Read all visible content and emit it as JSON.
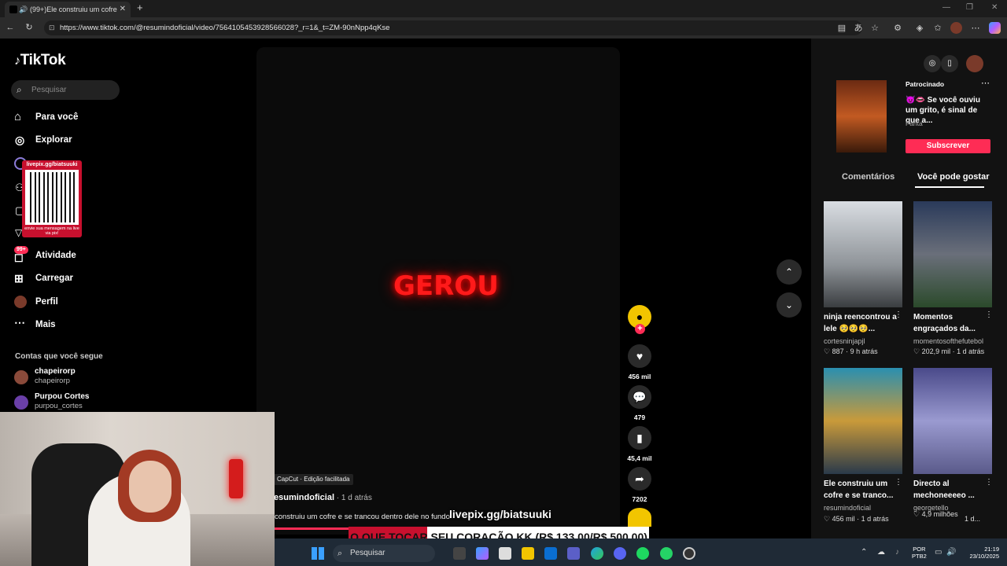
{
  "browser": {
    "tab_title": "(99+)Ele construiu um cofre",
    "url": "https://www.tiktok.com/@resumindoficial/video/7564105453928566028?_r=1&_t=ZM-90nNpp4qKse"
  },
  "sidebar": {
    "logo": "TikTok",
    "search_placeholder": "Pesquisar",
    "items": [
      {
        "label": "Para você",
        "icon": "home-icon"
      },
      {
        "label": "Explorar",
        "icon": "compass-icon"
      },
      {
        "label": "Atividade",
        "icon": "inbox-icon",
        "badge": "99+"
      },
      {
        "label": "Carregar",
        "icon": "plus-square-icon"
      },
      {
        "label": "Perfil",
        "icon": "avatar"
      },
      {
        "label": "Mais",
        "icon": "more-icon"
      }
    ],
    "following_title": "Contas que você segue",
    "following": [
      {
        "name": "chapeirorp",
        "handle": "chapeirorp"
      },
      {
        "name": "Purpou Cortes",
        "handle": "purpou_cortes"
      }
    ]
  },
  "qr_overlay": {
    "top_text": "livepix.gg/biatsuuki",
    "bottom_text": "envie sua mensagem na live via pix!"
  },
  "video": {
    "center_text": "GEROU",
    "capcut_tag": "CapCut · Edição facilitada",
    "username": "esumindoficial",
    "time_ago": " · 1 d atrás",
    "description": "construiu um cofre e se trancou dentro dele no fundo",
    "progress": 0.22
  },
  "actions": [
    {
      "name": "like",
      "count": "456 mil",
      "icon": "heart-icon"
    },
    {
      "name": "comment",
      "count": "479",
      "icon": "comment-icon"
    },
    {
      "name": "bookmark",
      "count": "45,4 mil",
      "icon": "bookmark-icon"
    },
    {
      "name": "share",
      "count": "7202",
      "icon": "share-icon"
    }
  ],
  "right_panel": {
    "ad": {
      "sponsored": "Patrocinado",
      "text": "😈👄 Se você ouviu um grito, é sinal de que a...",
      "brand": "Fanta",
      "button": "Subscrever"
    },
    "tabs": [
      "Comentários",
      "Você pode gostar"
    ],
    "cards": [
      {
        "title": "ninja reencontrou a lele 🥺🥺🥺...",
        "user": "cortesninjapjl",
        "likes": "887",
        "time": "9 h atrás"
      },
      {
        "title": "Momentos engraçados da...",
        "user": "momentosofthefutebol",
        "likes": "202,9 mil",
        "time": "1 d atrás"
      },
      {
        "title": "Ele construiu um cofre e se tranco...",
        "user": "resumindoficial",
        "likes": "456 mil",
        "time": "1 d atrás"
      },
      {
        "title": "Directo al mechoneeeeo ...",
        "user": "georgetello",
        "likes": "4,9 milhões",
        "time": "1 d..."
      }
    ]
  },
  "stream_overlay": {
    "livepix": "livepix.gg/biatsuuki",
    "ticker": "O QUE TOCAR SEU CORAÇÃO KK (R$ 133,00/R$ 500,00)"
  },
  "taskbar": {
    "search": "Pesquisar",
    "lang": "POR",
    "lang2": "PTB2",
    "time": "21:19",
    "date": "23/10/2025"
  },
  "colors": {
    "accent": "#fe2c55",
    "neon": "#ff1a1a"
  }
}
